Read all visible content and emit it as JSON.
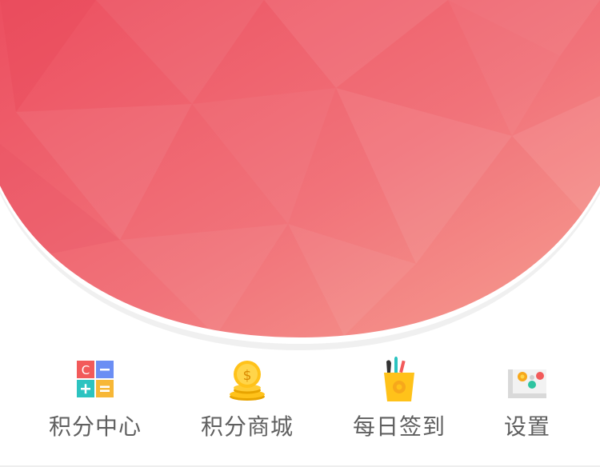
{
  "theme": {
    "hero_gradient_start": "#ec4f60",
    "hero_gradient_end": "#f6a092",
    "label_color": "#5f5f5f"
  },
  "menu": [
    {
      "label": "积分中心",
      "icon": "calculator-icon"
    },
    {
      "label": "积分商城",
      "icon": "coins-icon"
    },
    {
      "label": "每日签到",
      "icon": "pen-holder-icon"
    },
    {
      "label": "设置",
      "icon": "settings-panel-icon"
    }
  ]
}
